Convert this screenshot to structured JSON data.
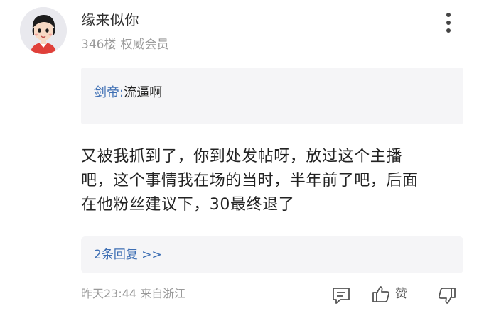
{
  "post": {
    "author": {
      "name": "缘来似你",
      "avatar_icon": "cartoon-avatar-icon"
    },
    "floor": "346楼",
    "user_badge": "权威会员",
    "more_icon": "more-vertical-icon",
    "quote": {
      "author": "剑帝",
      "separator": ":",
      "text": "流逼啊"
    },
    "content_lines": [
      "又被我抓到了，你到处发帖呀，放过这个主播",
      "吧，这个事情我在场的当时，半年前了吧，后面",
      "在他粉丝建议下，30最终退了"
    ],
    "replies_link": "2条回复 >>",
    "time": "昨天23:44",
    "location": "来自浙江",
    "actions": {
      "comment_icon": "comment-icon",
      "like_icon": "thumbs-up-icon",
      "like_label": "赞",
      "dislike_icon": "thumbs-down-icon"
    }
  },
  "colors": {
    "link_blue": "#3e6fb4",
    "meta_gray": "#9a9a9a",
    "panel_bg": "#f5f5f7",
    "text": "#222222"
  }
}
